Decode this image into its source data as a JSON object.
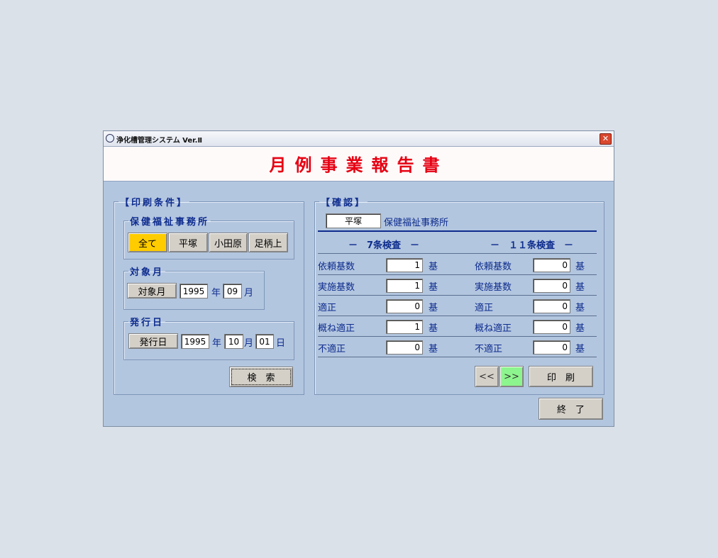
{
  "window": {
    "title": "浄化槽管理システム Ver.Ⅱ",
    "close": "✕"
  },
  "header": {
    "title": "月例事業報告書"
  },
  "print_conditions": {
    "legend": "【印刷条件】",
    "office": {
      "legend": "保健福祉事務所",
      "buttons": [
        "全て",
        "平塚",
        "小田原",
        "足柄上"
      ],
      "selected": "全て",
      "selected_color": "#ffcc00"
    },
    "target_month": {
      "legend": "対象月",
      "button": "対象月",
      "year": "1995",
      "year_unit": "年",
      "month": "09",
      "month_unit": "月"
    },
    "issue_date": {
      "legend": "発行日",
      "button": "発行日",
      "year": "1995",
      "year_unit": "年",
      "month": "10",
      "month_unit": "月",
      "day": "01",
      "day_unit": "日"
    },
    "search_button": "検　索"
  },
  "confirm": {
    "legend": "【確認】",
    "office_value": "平塚",
    "office_suffix": "保健福祉事務所",
    "col7_title": "－　7条検査　－",
    "col11_title": "－　１１条検査　－",
    "unit": "基",
    "rows": [
      {
        "label": "依頼基数",
        "v7": "1",
        "v11": "0"
      },
      {
        "label": "実施基数",
        "v7": "1",
        "v11": "0"
      },
      {
        "label": "適正",
        "v7": "0",
        "v11": "0"
      },
      {
        "label": "概ね適正",
        "v7": "1",
        "v11": "0"
      },
      {
        "label": "不適正",
        "v7": "0",
        "v11": "0"
      }
    ],
    "prev_button": "<<",
    "next_button": ">>",
    "next_color": "#8df58d",
    "print_button": "印　刷"
  },
  "exit_button": "終　了"
}
